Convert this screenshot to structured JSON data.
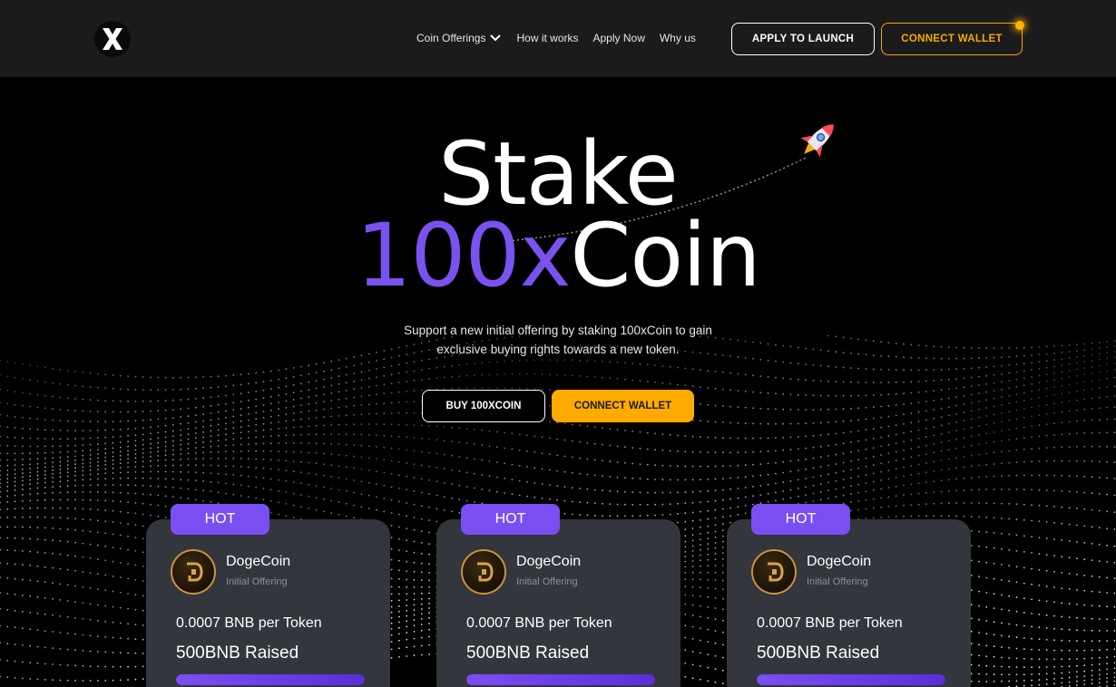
{
  "header": {
    "logo_letter": "X",
    "nav": [
      {
        "label": "Coin Offerings",
        "has_dropdown": true
      },
      {
        "label": "How it works"
      },
      {
        "label": "Apply Now"
      },
      {
        "label": "Why us"
      }
    ],
    "apply_button": "APPLY TO LAUNCH",
    "wallet_button": "CONNECT WALLET"
  },
  "hero": {
    "title_line1": "Stake",
    "title_accent": "100x",
    "title_rest": "Coin",
    "subtitle_line1": "Support a new initial offering by staking 100xCoin to gain",
    "subtitle_line2": "exclusive buying rights towards a new token.",
    "buy_button": "BUY 100XCOIN",
    "connect_button": "CONNECT WALLET"
  },
  "cards": [
    {
      "badge": "HOT",
      "name": "DogeCoin",
      "subtitle": "Initial Offering",
      "price": "0.0007 BNB per Token",
      "raised": "500BNB Raised",
      "progress": 1.0
    },
    {
      "badge": "HOT",
      "name": "DogeCoin",
      "subtitle": "Initial Offering",
      "price": "0.0007 BNB per Token",
      "raised": "500BNB Raised",
      "progress": 1.0
    },
    {
      "badge": "HOT",
      "name": "DogeCoin",
      "subtitle": "Initial Offering",
      "price": "0.0007 BNB per Token",
      "raised": "500BNB Raised",
      "progress": 1.0
    }
  ],
  "colors": {
    "accent_purple": "#7b52f0",
    "gold": "#ffab00",
    "header_bg": "#1b1b1b",
    "card_bg": "#33363c"
  }
}
